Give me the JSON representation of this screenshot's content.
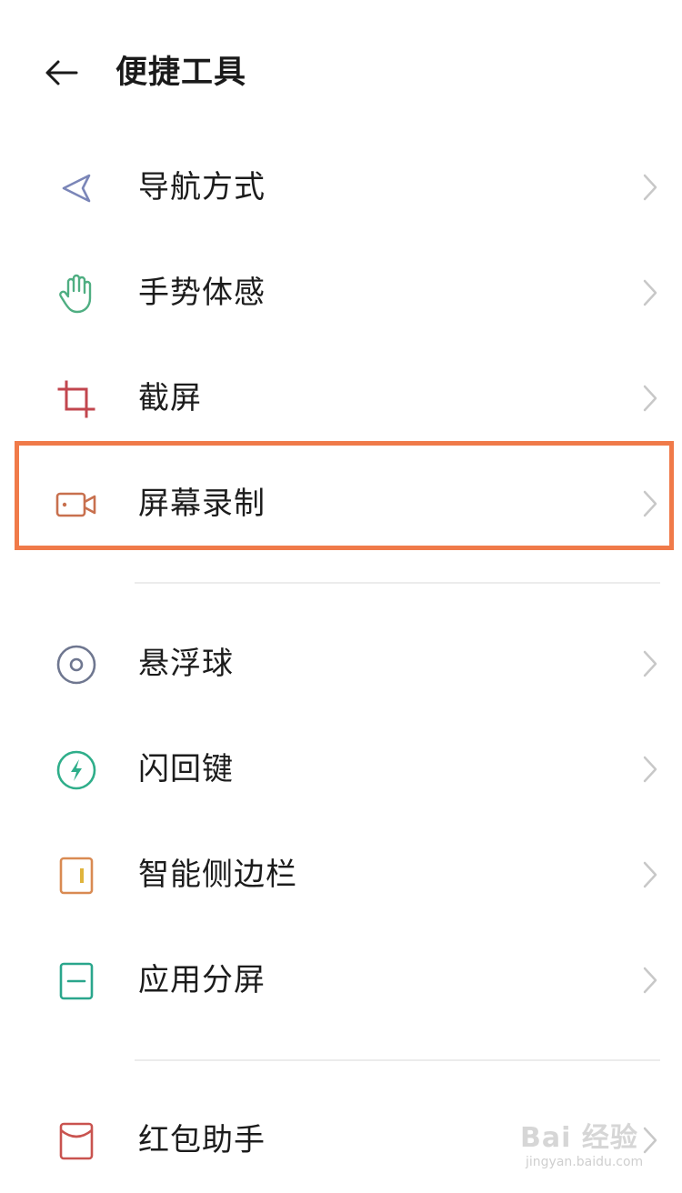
{
  "header": {
    "title": "便捷工具",
    "back_icon": "arrow-left-icon"
  },
  "items": [
    {
      "label": "导航方式",
      "icon": "navigation-arrow-icon",
      "color": "#7b86b8"
    },
    {
      "label": "手势体感",
      "icon": "hand-gesture-icon",
      "color": "#4fae82"
    },
    {
      "label": "截屏",
      "icon": "crop-icon",
      "color": "#c2464e"
    },
    {
      "label": "屏幕录制",
      "icon": "video-camera-icon",
      "color": "#c8704e",
      "highlighted": true
    },
    {
      "label": "悬浮球",
      "icon": "floating-ball-icon",
      "color": "#6f7790"
    },
    {
      "label": "闪回键",
      "icon": "lightning-icon",
      "color": "#2fae8a"
    },
    {
      "label": "智能侧边栏",
      "icon": "sidebar-icon",
      "color": "#d98a52"
    },
    {
      "label": "应用分屏",
      "icon": "split-screen-icon",
      "color": "#2aa68c"
    },
    {
      "label": "红包助手",
      "icon": "envelope-icon",
      "color": "#c9534f"
    }
  ],
  "chevron_icon": "chevron-right-icon",
  "highlight_color": "#f07a49",
  "watermark": {
    "main": "Bai 经验",
    "sub": "jingyan.baidu.com"
  }
}
